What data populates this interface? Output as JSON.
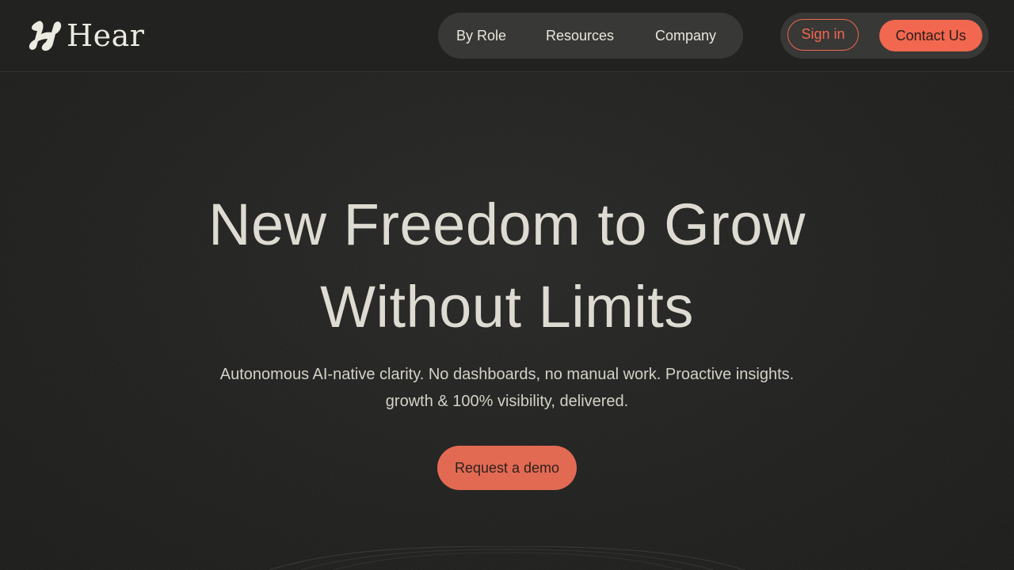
{
  "header": {
    "logo_text": "Hear",
    "logo_icon": "hear-logo-icon",
    "nav": [
      {
        "label": "By Role"
      },
      {
        "label": "Resources"
      },
      {
        "label": "Company"
      }
    ],
    "sign_in_label": "Sign in",
    "contact_label": "Contact Us"
  },
  "hero": {
    "headline_line1": "New Freedom to Grow",
    "headline_line2": "Without Limits",
    "subtext_line1": "Autonomous AI-native clarity. No dashboards, no manual work. Proactive insights.",
    "subtext_line2": "growth & 100% visibility, delivered.",
    "cta_label": "Request a demo"
  },
  "colors": {
    "accent": "#f2674f",
    "background": "#1d1d1c",
    "text": "#dedcd2"
  }
}
